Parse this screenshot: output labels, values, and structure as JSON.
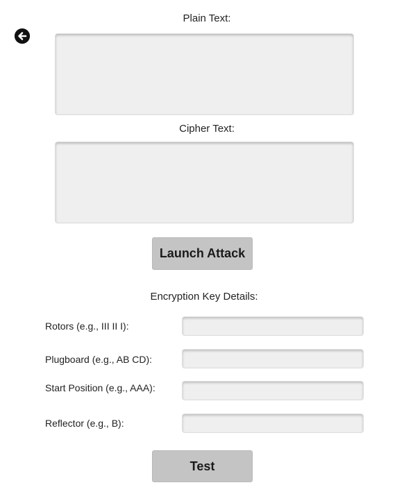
{
  "nav": {
    "back_icon": "arrow-left-circle-icon"
  },
  "plain_text": {
    "label": "Plain Text:",
    "value": ""
  },
  "cipher_text": {
    "label": "Cipher Text:",
    "value": ""
  },
  "launch_attack": {
    "label": "Launch Attack"
  },
  "key_details": {
    "heading": "Encryption Key Details:",
    "fields": [
      {
        "label": "Rotors (e.g., III II I):",
        "value": ""
      },
      {
        "label": "Plugboard (e.g., AB CD):",
        "value": ""
      },
      {
        "label": "Start Position (e.g., AAA):",
        "value": ""
      },
      {
        "label": "Reflector (e.g., B):",
        "value": ""
      }
    ]
  },
  "test": {
    "label": "Test"
  }
}
